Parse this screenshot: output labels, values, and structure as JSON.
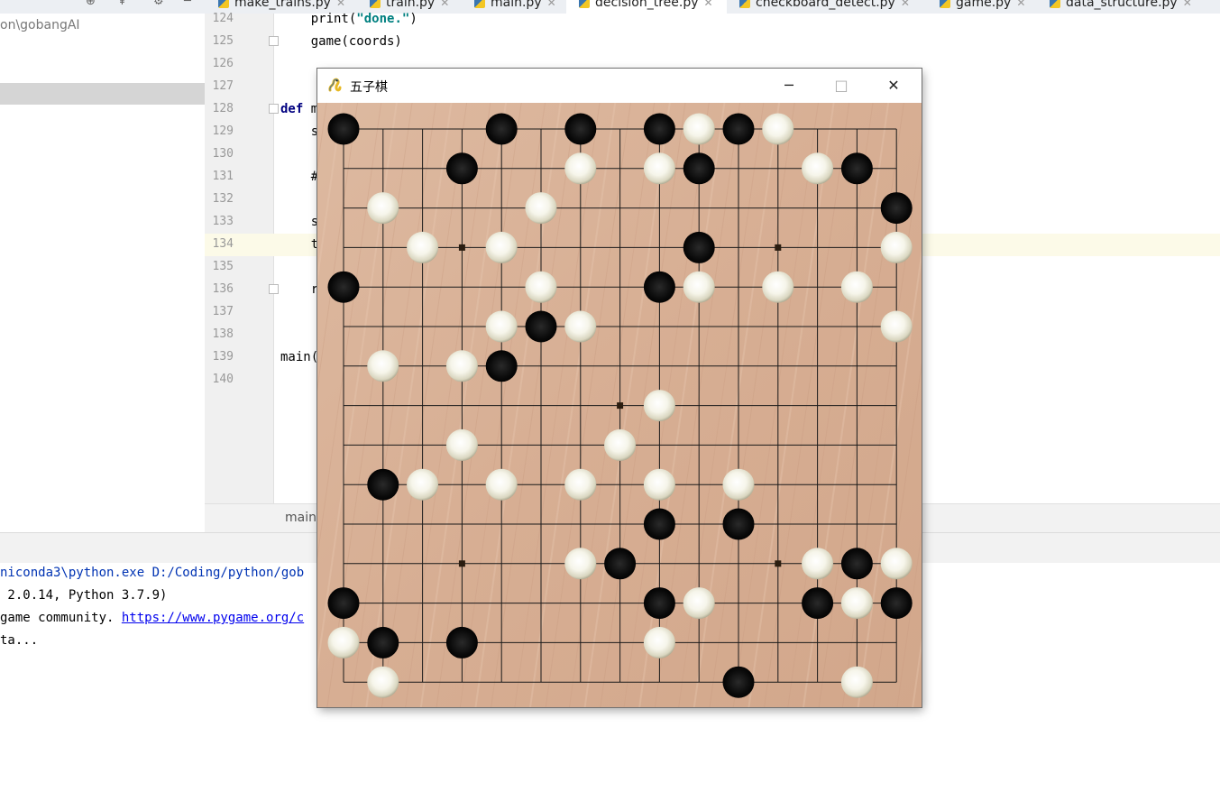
{
  "tabs": [
    {
      "label": "make_trains.py",
      "active": false
    },
    {
      "label": "train.py",
      "active": false
    },
    {
      "label": "main.py",
      "active": false
    },
    {
      "label": "decision_tree.py",
      "active": true
    },
    {
      "label": "checkboard_detect.py",
      "active": false
    },
    {
      "label": "game.py",
      "active": false
    },
    {
      "label": "data_structure.py",
      "active": false
    }
  ],
  "project": {
    "path": "on\\gobangAI"
  },
  "editor": {
    "lines": [
      {
        "n": "124",
        "code": "    print(\"done.\")"
      },
      {
        "n": "125",
        "code": "    game(coords)"
      },
      {
        "n": "126",
        "code": ""
      },
      {
        "n": "127",
        "code": ""
      },
      {
        "n": "128",
        "code": "def m"
      },
      {
        "n": "129",
        "code": "    s"
      },
      {
        "n": "130",
        "code": ""
      },
      {
        "n": "131",
        "code": "    #"
      },
      {
        "n": "132",
        "code": ""
      },
      {
        "n": "133",
        "code": "    s"
      },
      {
        "n": "134",
        "code": "    t"
      },
      {
        "n": "135",
        "code": ""
      },
      {
        "n": "136",
        "code": "    r"
      },
      {
        "n": "137",
        "code": ""
      },
      {
        "n": "138",
        "code": ""
      },
      {
        "n": "139",
        "code": "main("
      },
      {
        "n": "140",
        "code": ""
      }
    ],
    "breadcrumb": "main"
  },
  "console": {
    "line1": "niconda3\\python.exe D:/Coding/python/gob",
    "line2": " 2.0.14, Python 3.7.9)",
    "line3_text": "game community. ",
    "line3_link": "https://www.pygame.org/c",
    "line4": "ta..."
  },
  "game_window": {
    "title": "五子棋",
    "min_label": "─",
    "max_label": "□",
    "close_label": "✕",
    "board_size": 15,
    "star_points": [
      [
        3,
        3
      ],
      [
        3,
        11
      ],
      [
        7,
        7
      ],
      [
        11,
        3
      ],
      [
        11,
        11
      ]
    ],
    "stones_black": [
      [
        0,
        0
      ],
      [
        0,
        4
      ],
      [
        0,
        6
      ],
      [
        0,
        8
      ],
      [
        0,
        10
      ],
      [
        1,
        3
      ],
      [
        1,
        9
      ],
      [
        1,
        13
      ],
      [
        2,
        14
      ],
      [
        3,
        9
      ],
      [
        4,
        0
      ],
      [
        4,
        8
      ],
      [
        5,
        5
      ],
      [
        6,
        4
      ],
      [
        9,
        1
      ],
      [
        10,
        8
      ],
      [
        10,
        10
      ],
      [
        11,
        7
      ],
      [
        11,
        13
      ],
      [
        12,
        0
      ],
      [
        12,
        8
      ],
      [
        12,
        12
      ],
      [
        12,
        14
      ],
      [
        13,
        1
      ],
      [
        13,
        3
      ],
      [
        14,
        10
      ]
    ],
    "stones_white": [
      [
        0,
        9
      ],
      [
        0,
        11
      ],
      [
        1,
        6
      ],
      [
        1,
        8
      ],
      [
        1,
        12
      ],
      [
        2,
        1
      ],
      [
        2,
        5
      ],
      [
        3,
        2
      ],
      [
        3,
        4
      ],
      [
        3,
        14
      ],
      [
        4,
        5
      ],
      [
        4,
        9
      ],
      [
        4,
        11
      ],
      [
        4,
        13
      ],
      [
        5,
        4
      ],
      [
        5,
        6
      ],
      [
        5,
        14
      ],
      [
        6,
        1
      ],
      [
        6,
        3
      ],
      [
        7,
        8
      ],
      [
        8,
        3
      ],
      [
        8,
        7
      ],
      [
        9,
        2
      ],
      [
        9,
        4
      ],
      [
        9,
        6
      ],
      [
        9,
        8
      ],
      [
        9,
        10
      ],
      [
        11,
        6
      ],
      [
        11,
        12
      ],
      [
        11,
        14
      ],
      [
        12,
        9
      ],
      [
        12,
        13
      ],
      [
        13,
        0
      ],
      [
        13,
        8
      ],
      [
        14,
        1
      ],
      [
        14,
        13
      ]
    ]
  }
}
